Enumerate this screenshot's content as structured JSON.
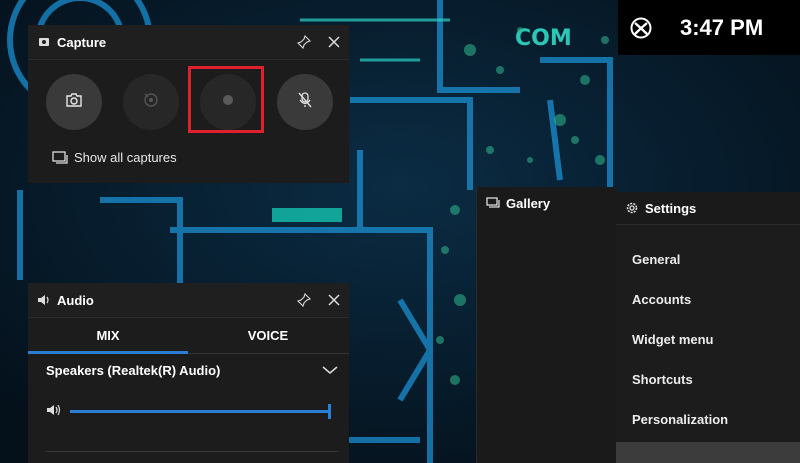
{
  "capture": {
    "title": "Capture",
    "icon": "capture-icon",
    "pin_icon": "pin-icon",
    "close_icon": "close-icon",
    "buttons": [
      {
        "icon": "camera-icon",
        "state": "enabled"
      },
      {
        "icon": "record-last-icon",
        "state": "disabled"
      },
      {
        "icon": "record-dot-icon",
        "state": "disabled",
        "highlighted": true
      },
      {
        "icon": "mic-off-icon",
        "state": "enabled"
      }
    ],
    "show_all_label": "Show all captures",
    "highlight_color": "#e0212d"
  },
  "audio": {
    "title": "Audio",
    "icon": "speaker-icon",
    "tabs": [
      {
        "label": "MIX",
        "active": true
      },
      {
        "label": "VOICE",
        "active": false
      }
    ],
    "device_label": "Speakers (Realtek(R) Audio)",
    "volume_fraction": 1.0,
    "accent": "#2a7fd4"
  },
  "clock": {
    "icon": "xbox-icon",
    "time": "3:47 PM"
  },
  "gallery": {
    "title": "Gallery",
    "icon": "gallery-icon"
  },
  "settings": {
    "title": "Settings",
    "icon": "gear-icon",
    "items": [
      {
        "label": "General"
      },
      {
        "label": "Accounts"
      },
      {
        "label": "Widget menu"
      },
      {
        "label": "Shortcuts"
      },
      {
        "label": "Personalization"
      }
    ]
  },
  "background": {
    "text": "COM"
  }
}
